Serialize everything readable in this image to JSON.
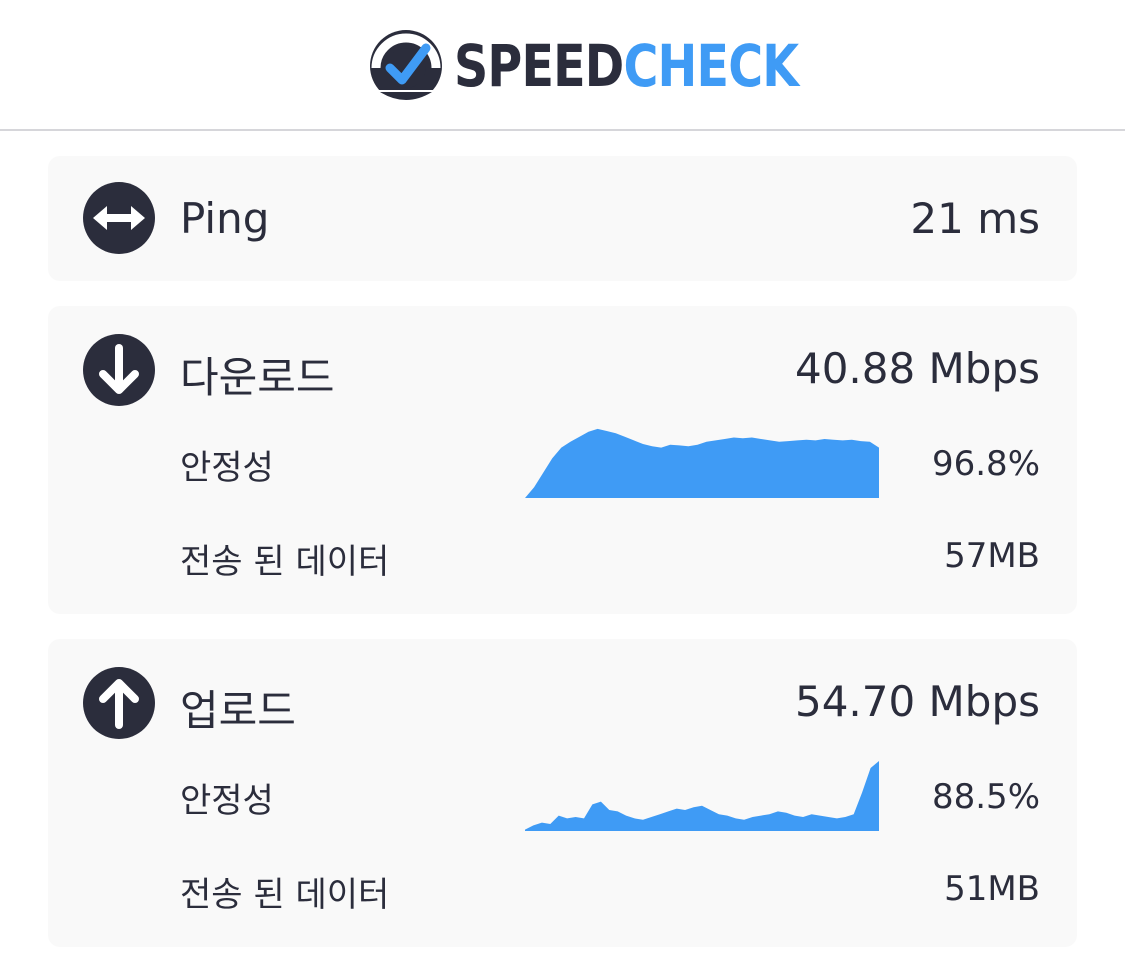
{
  "brand": {
    "part1": "SPEED",
    "part2": "CHECK",
    "dark_color": "#2b2d3c",
    "accent_color": "#3f9bf5",
    "icon": "speedometer-check-icon"
  },
  "ping": {
    "label": "Ping",
    "value": "21 ms",
    "icon": "horizontal-arrows-icon"
  },
  "download": {
    "label": "다운로드",
    "value": "40.88 Mbps",
    "icon": "arrow-down-icon",
    "stability_label": "안정성",
    "stability_value": "96.8%",
    "data_label": "전송 된 데이터",
    "data_value": "57MB",
    "sparkline": [
      0.0,
      0.15,
      0.35,
      0.55,
      0.7,
      0.78,
      0.85,
      0.92,
      0.96,
      0.93,
      0.9,
      0.85,
      0.8,
      0.75,
      0.72,
      0.7,
      0.74,
      0.73,
      0.72,
      0.74,
      0.78,
      0.8,
      0.82,
      0.84,
      0.83,
      0.84,
      0.82,
      0.8,
      0.78,
      0.79,
      0.8,
      0.81,
      0.8,
      0.82,
      0.81,
      0.8,
      0.81,
      0.79,
      0.78,
      0.7
    ]
  },
  "upload": {
    "label": "업로드",
    "value": "54.70 Mbps",
    "icon": "arrow-up-icon",
    "stability_label": "안정성",
    "stability_value": "88.5%",
    "data_label": "전송 된 데이터",
    "data_value": "51MB",
    "sparkline": [
      0.02,
      0.08,
      0.12,
      0.1,
      0.22,
      0.18,
      0.2,
      0.18,
      0.38,
      0.42,
      0.3,
      0.28,
      0.22,
      0.18,
      0.16,
      0.2,
      0.24,
      0.28,
      0.32,
      0.3,
      0.34,
      0.36,
      0.3,
      0.24,
      0.22,
      0.18,
      0.16,
      0.2,
      0.22,
      0.24,
      0.28,
      0.26,
      0.22,
      0.2,
      0.24,
      0.22,
      0.2,
      0.18,
      0.2,
      0.24,
      0.55,
      0.9,
      1.0
    ]
  }
}
